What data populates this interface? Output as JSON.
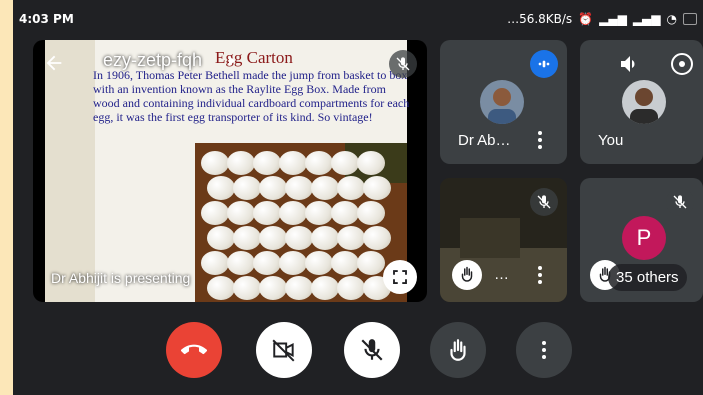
{
  "status_bar": {
    "time": "4:03 PM",
    "speed": "…56.8KB/s"
  },
  "meeting": {
    "code": "ezy-zetp-fqh",
    "presenting_text": "Dr Abhijit is presenting"
  },
  "slide": {
    "title": "Egg Carton",
    "body": "In 1906, Thomas Peter Bethell made the jump from basket to box with an invention known as the Raylite Egg Box. Made from wood and containing individual cardboard compartments for each egg, it was the first egg transporter of its kind. So vintage!"
  },
  "participants": [
    {
      "name": "Dr Ab…",
      "tile": "active-speaker"
    },
    {
      "name": "You",
      "tile": "self"
    },
    {
      "name": "…",
      "tile": "camera"
    },
    {
      "name": "35 others",
      "initial": "P",
      "tile": "others"
    }
  ],
  "colors": {
    "background": "#202124",
    "tile": "#3c4043",
    "end_call": "#ea4335",
    "speaking": "#1a73e8",
    "avatar_p": "#c2185b"
  },
  "controls": [
    {
      "name": "end-call",
      "icon": "phone-hangup-icon"
    },
    {
      "name": "camera-off",
      "icon": "video-off-icon"
    },
    {
      "name": "mic-off",
      "icon": "mic-off-icon"
    },
    {
      "name": "raise-hand",
      "icon": "hand-icon"
    },
    {
      "name": "more-options",
      "icon": "more-vert-icon"
    }
  ]
}
